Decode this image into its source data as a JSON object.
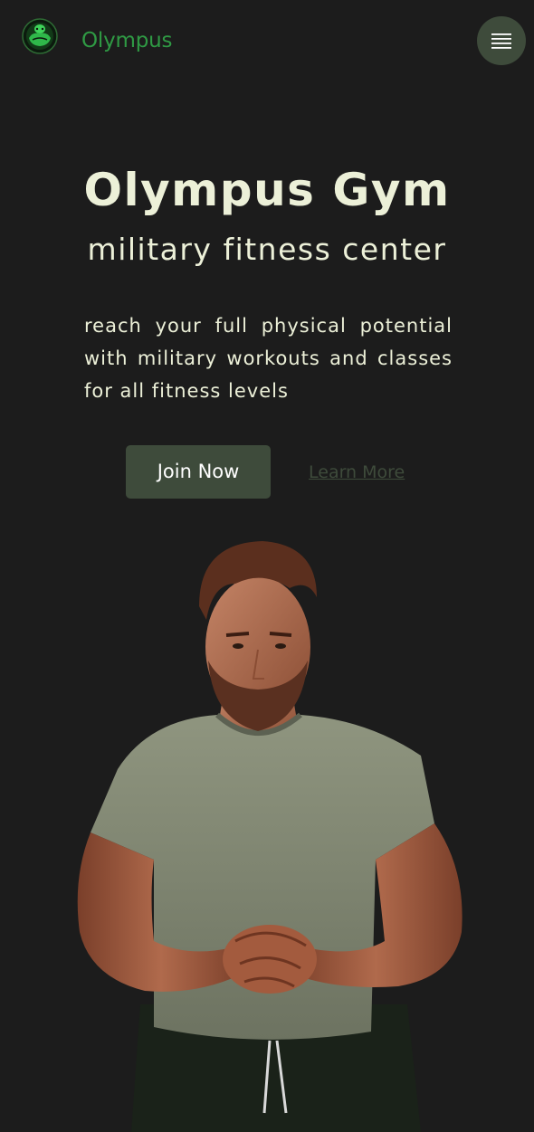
{
  "header": {
    "brand_name": "Olympus",
    "logo_icon": "muscle-warrior-logo-icon",
    "menu_icon": "hamburger-menu-icon"
  },
  "hero": {
    "title": "Olympus Gym",
    "subtitle": "military fitness center",
    "description": "reach your full physical potential with military workouts and classes for all fitness levels",
    "primary_button": "Join Now",
    "secondary_link": "Learn More",
    "image": "muscular-man-portrait"
  },
  "colors": {
    "background": "#1c1c1c",
    "brand_green": "#2f9a44",
    "accent_dark_green": "#3e4b3b",
    "text_cream": "#ecf0d8"
  }
}
